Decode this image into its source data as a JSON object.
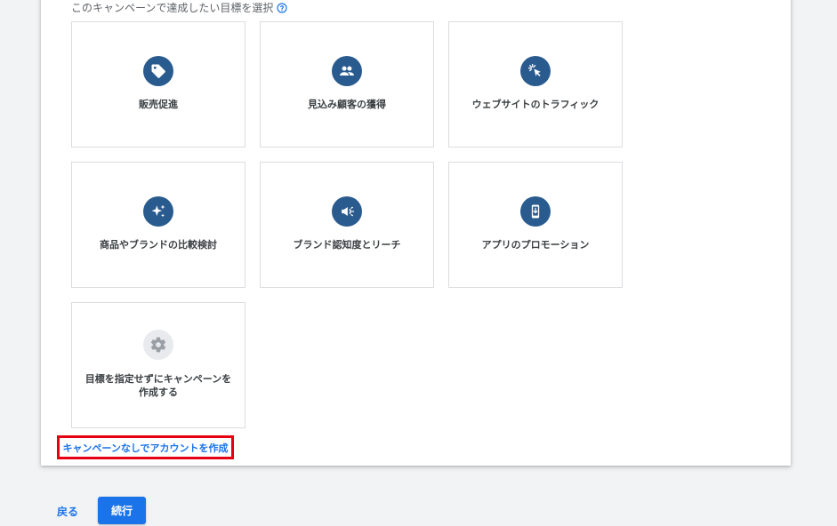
{
  "heading": {
    "text": "このキャンペーンで達成したい目標を選択"
  },
  "goals": [
    {
      "label": "販売促進",
      "icon": "tag-icon"
    },
    {
      "label": "見込み顧客の獲得",
      "icon": "people-icon"
    },
    {
      "label": "ウェブサイトのトラフィック",
      "icon": "cursor-click-icon"
    },
    {
      "label": "商品やブランドの比較検討",
      "icon": "sparkle-icon"
    },
    {
      "label": "ブランド認知度とリーチ",
      "icon": "megaphone-icon"
    },
    {
      "label": "アプリのプロモーション",
      "icon": "phone-download-icon"
    },
    {
      "label": "目標を指定せずにキャンペーンを作成する",
      "icon": "gear-icon"
    }
  ],
  "link": {
    "text": "キャンペーンなしでアカウントを作成"
  },
  "footer": {
    "back": "戻る",
    "continue": "続行"
  },
  "colors": {
    "accent": "#1a73e8",
    "icon_bg": "#2a5b8f",
    "highlight": "#e60012"
  }
}
